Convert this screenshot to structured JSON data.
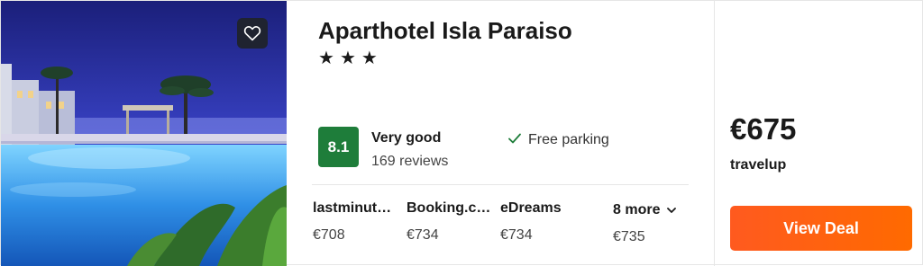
{
  "hotel": {
    "name": "Aparthotel Isla Paraiso",
    "stars": [
      "★",
      "★",
      "★"
    ],
    "favorite_icon": "heart-icon"
  },
  "rating": {
    "score": "8.1",
    "label": "Very good",
    "reviews": "169 reviews",
    "badge_color": "#1e7d3a"
  },
  "amenity": {
    "icon": "check-icon",
    "label": "Free parking"
  },
  "providers": [
    {
      "name": "lastminut…",
      "price": "€708"
    },
    {
      "name": "Booking.c…",
      "price": "€734"
    },
    {
      "name": "eDreams",
      "price": "€734"
    }
  ],
  "more": {
    "label": "8 more",
    "price": "€735",
    "icon": "chevron-down-icon"
  },
  "deal": {
    "price": "€675",
    "provider": "travelup",
    "button_label": "View Deal",
    "button_color": "#ff5a1f"
  }
}
